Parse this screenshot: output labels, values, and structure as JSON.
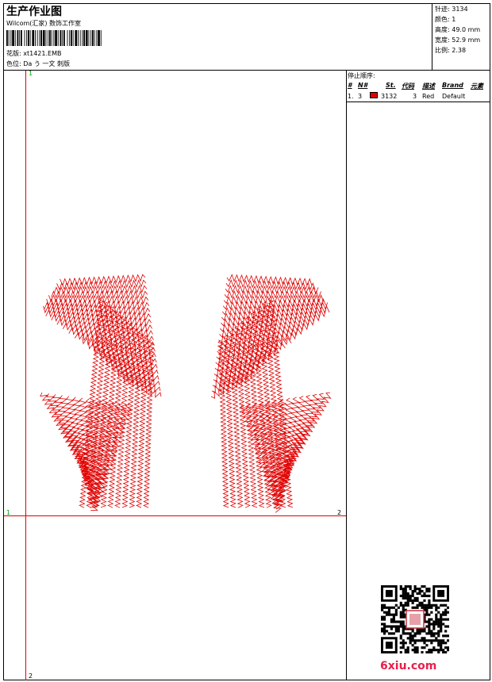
{
  "header": {
    "title": "生产作业图",
    "company": "Wilcom(汇家) 数饰工作室",
    "design_file_label": "花版:",
    "design_file": "xt1421.EMB",
    "color_label": "色位:",
    "color_value": "Da う 一文  刺版"
  },
  "stats": {
    "stitches": "针迹: 3134",
    "colors": "颜色: 1",
    "height": "高度: 49.0 mm",
    "width": "宽度: 52.9 mm",
    "ratio": "比例: 2.38"
  },
  "stop_sequence": {
    "title": "停止顺序:",
    "headers": {
      "hash": "#",
      "n": "N#",
      "st": "St.",
      "code": "代码",
      "desc": "描述",
      "brand": "Brand",
      "elem": "元素"
    },
    "rows": [
      {
        "index": "1.",
        "n": "3",
        "st": "3132",
        "code": "3",
        "desc": "Red",
        "brand": "Default",
        "color": "#e00000"
      }
    ]
  },
  "guides": {
    "v_top": "1",
    "v_bottom": "2",
    "h_left": "1",
    "h_right": "2"
  },
  "design_colors": {
    "thread": "#e00000"
  },
  "watermark": {
    "text": "6xiu.com",
    "color": "#e8204a"
  }
}
